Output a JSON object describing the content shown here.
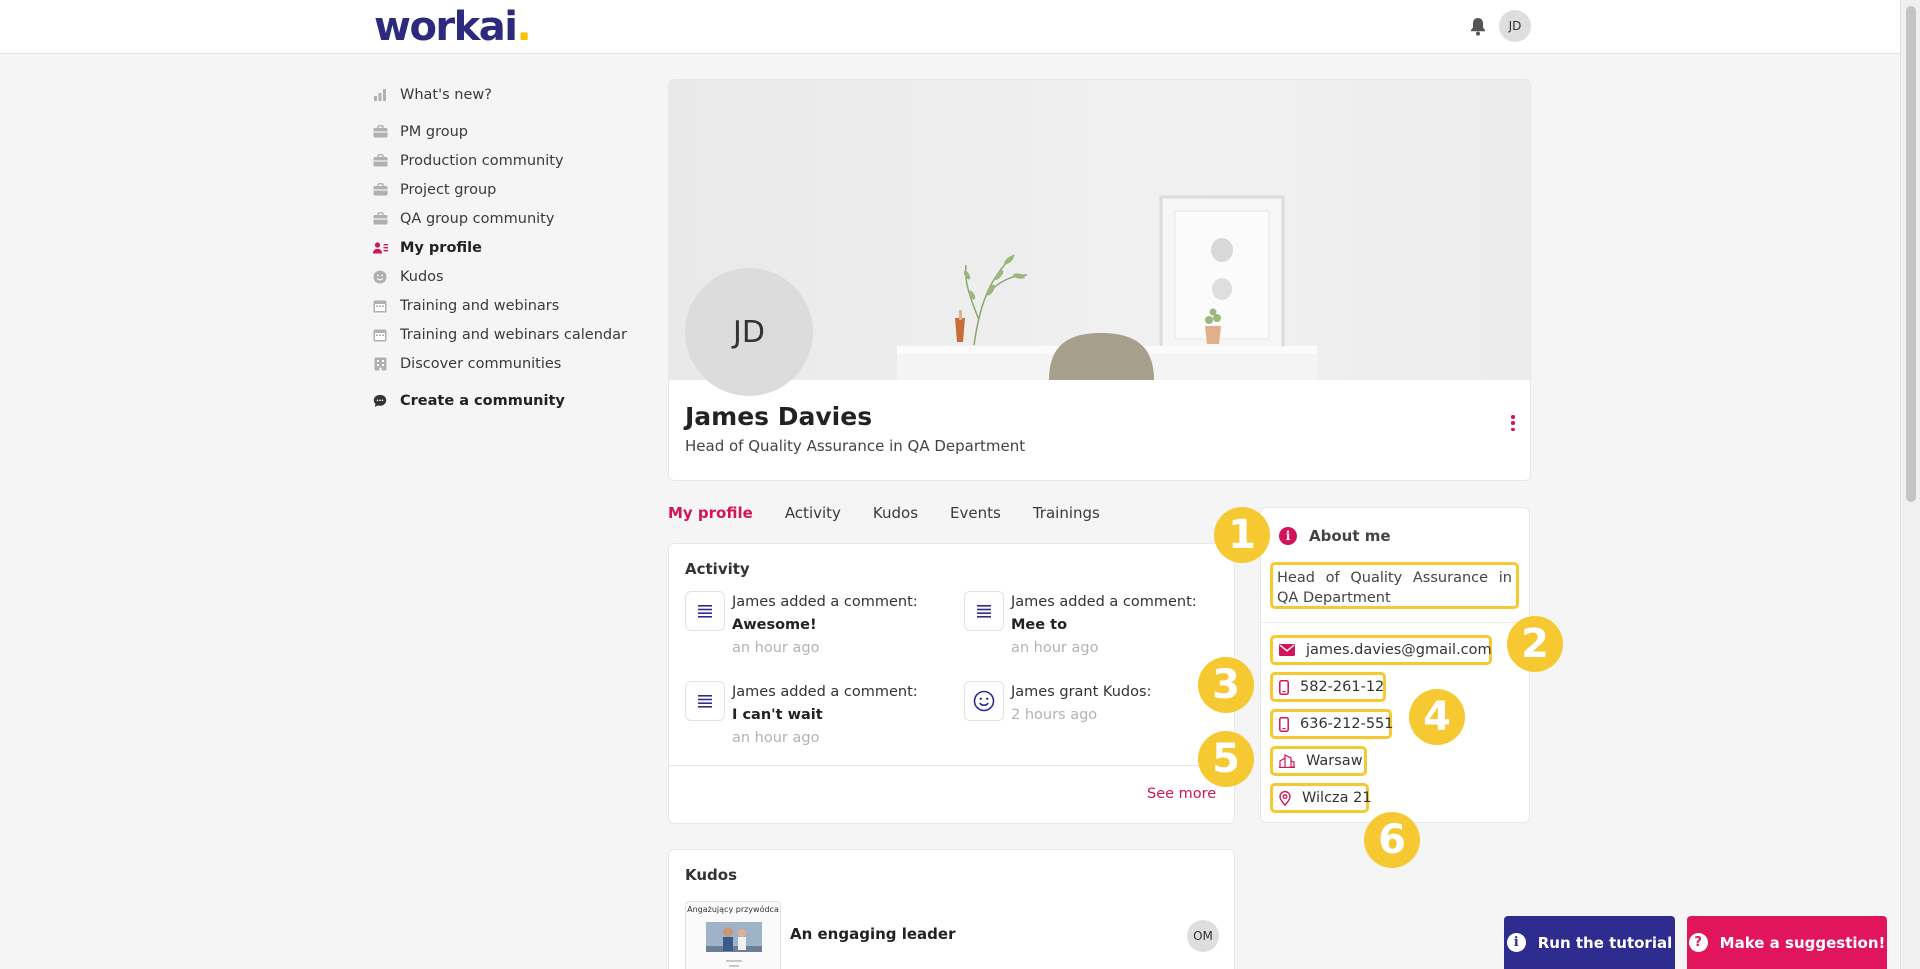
{
  "brand": {
    "logo_text": "workai",
    "logo_dot": ".",
    "primary": "#2d2a7e",
    "accent": "#d3145a",
    "highlight": "#f6c832"
  },
  "header": {
    "user_initials": "JD",
    "notification_icon": "bell-icon"
  },
  "sidebar": {
    "items": [
      {
        "label": "What's new?",
        "icon": "bar-chart-icon"
      },
      {
        "label": "PM group",
        "icon": "briefcase-icon"
      },
      {
        "label": "Production community",
        "icon": "briefcase-icon"
      },
      {
        "label": "Project group",
        "icon": "briefcase-icon"
      },
      {
        "label": "QA group community",
        "icon": "briefcase-icon"
      },
      {
        "label": "My profile",
        "icon": "user-list-icon"
      },
      {
        "label": "Kudos",
        "icon": "smiley-icon"
      },
      {
        "label": "Training and webinars",
        "icon": "calendar-icon"
      },
      {
        "label": "Training and webinars calendar",
        "icon": "calendar-icon"
      },
      {
        "label": "Discover communities",
        "icon": "building-icon"
      }
    ],
    "create_label": "Create a community"
  },
  "profile": {
    "initials": "JD",
    "name": "James Davies",
    "title": "Head of Quality Assurance in QA Department"
  },
  "tabs": [
    {
      "label": "My profile"
    },
    {
      "label": "Activity"
    },
    {
      "label": "Kudos"
    },
    {
      "label": "Events"
    },
    {
      "label": "Trainings"
    }
  ],
  "activity": {
    "title": "Activity",
    "items": [
      {
        "text": "James added a comment:",
        "detail": "Awesome!",
        "time": "an hour ago"
      },
      {
        "text": "James added a comment:",
        "detail": "Mee to",
        "time": "an hour ago"
      },
      {
        "text": "James added a comment:",
        "detail": "I can't wait",
        "time": "an hour ago"
      },
      {
        "text": "James grant Kudos:",
        "detail": "",
        "time": "2 hours ago"
      }
    ],
    "see_more": "See more"
  },
  "kudos": {
    "title": "Kudos",
    "thumb_label": "Angażujący przywódca",
    "name": "An engaging leader",
    "giver_initials": "OM"
  },
  "about": {
    "title": "About me",
    "description": "Head of Quality Assurance in QA Department",
    "email": "james.davies@gmail.com",
    "phone": "582-261-12",
    "mobile": "636-212-551",
    "city": "Warsaw",
    "address": "Wilcza 21"
  },
  "callouts": [
    "1",
    "2",
    "3",
    "4",
    "5",
    "6"
  ],
  "buttons": {
    "tutorial": "Run the tutorial",
    "suggest": "Make a suggestion!"
  }
}
